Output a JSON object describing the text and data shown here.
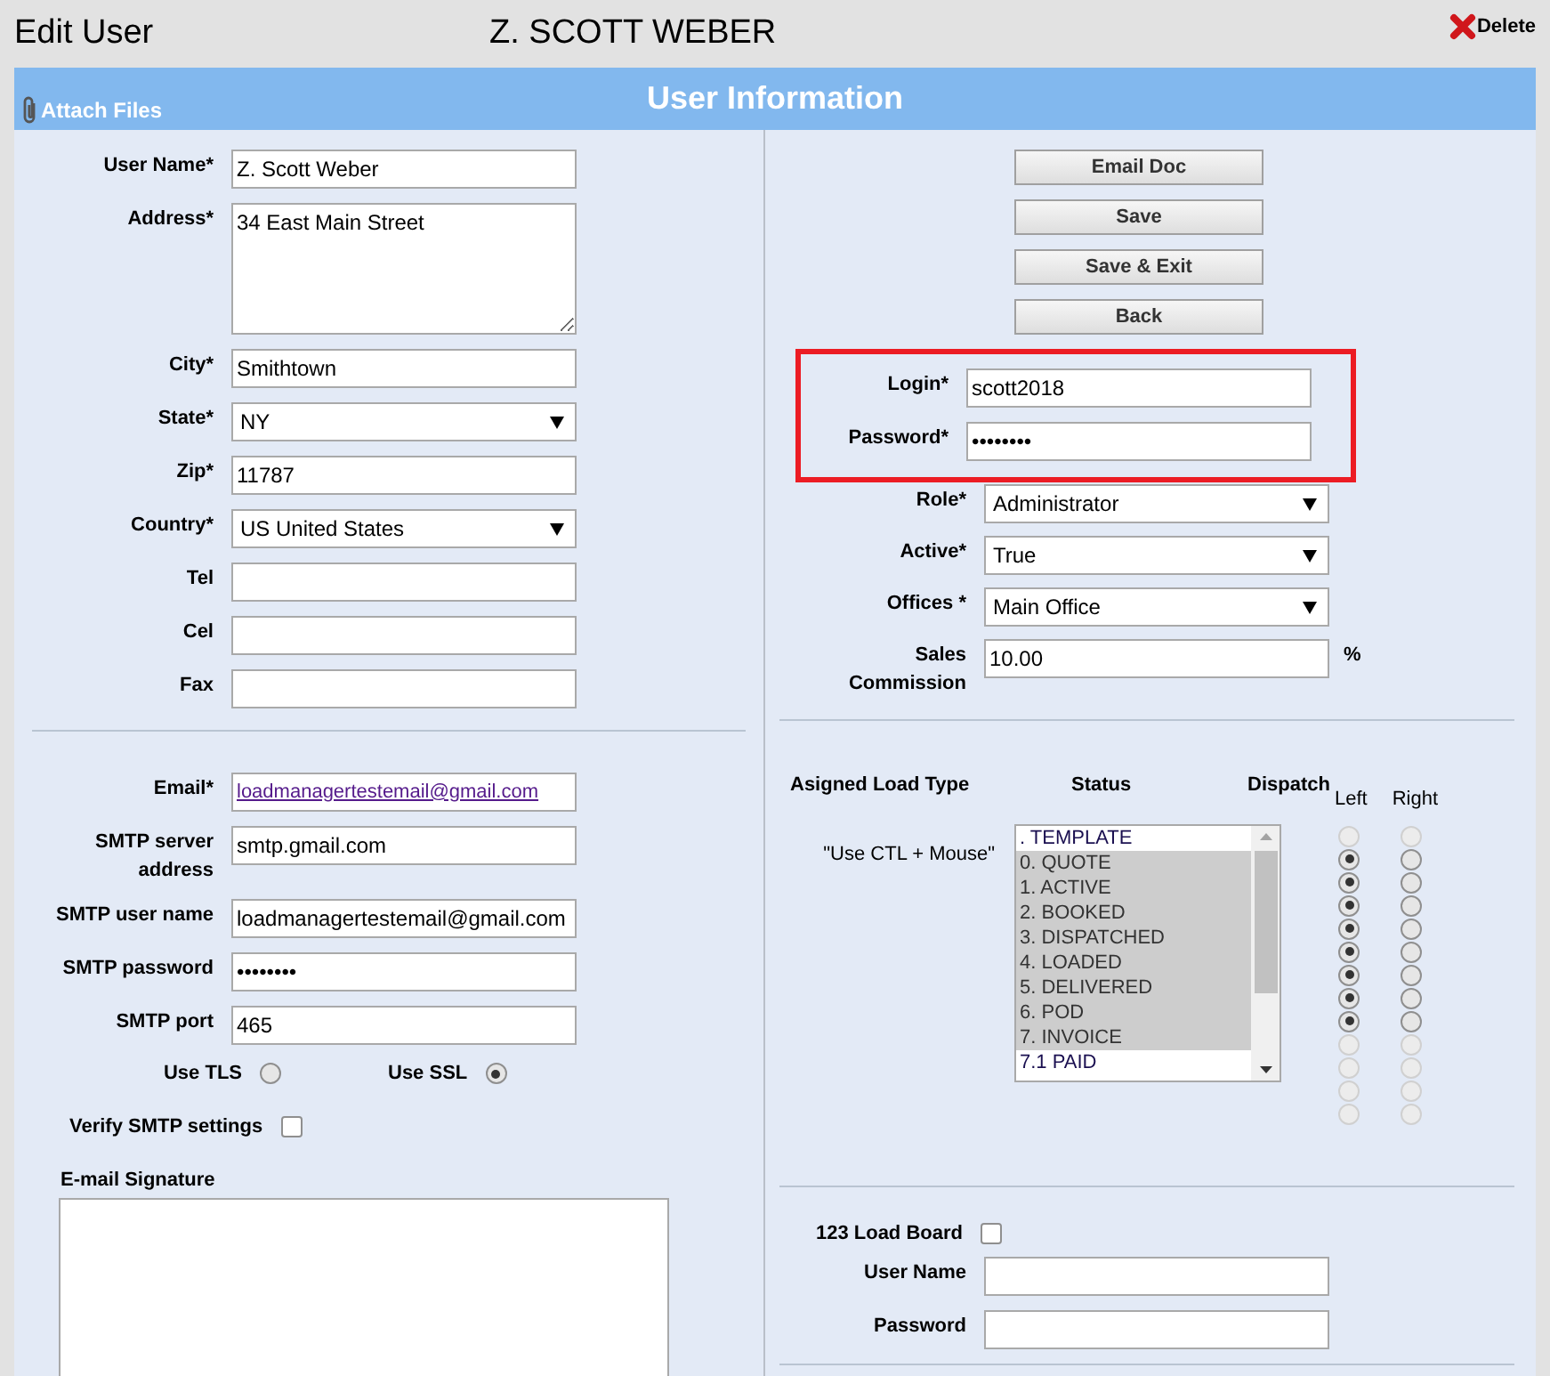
{
  "header": {
    "title": "Edit User",
    "name": "Z. SCOTT WEBER",
    "delete": "Delete"
  },
  "banner": {
    "attach": "Attach Files",
    "title": "User Information"
  },
  "profile_fields": [
    {
      "kind": "text",
      "label": "User Name*",
      "value": "Z. Scott Weber"
    },
    {
      "kind": "textarea",
      "label": "Address*",
      "value": "34 East Main Street"
    },
    {
      "kind": "text",
      "label": "City*",
      "value": "Smithtown"
    },
    {
      "kind": "select",
      "label": "State*",
      "value": "NY"
    },
    {
      "kind": "text",
      "label": "Zip*",
      "value": "11787"
    },
    {
      "kind": "select",
      "label": "Country*",
      "value": "US United States"
    },
    {
      "kind": "text",
      "label": "Tel"
    },
    {
      "kind": "text",
      "label": "Cel"
    },
    {
      "kind": "text",
      "label": "Fax"
    }
  ],
  "email_fields": [
    {
      "kind": "link",
      "label": "Email*",
      "value": "loadmanagertestemail@gmail.com"
    },
    {
      "kind": "text",
      "label": "SMTP server address",
      "value": "smtp.gmail.com"
    },
    {
      "kind": "text",
      "label": "SMTP user name",
      "value": "loadmanagertestemail@gmail.com"
    },
    {
      "kind": "text",
      "label": "SMTP password",
      "value": "••••••••"
    },
    {
      "kind": "text",
      "label": "SMTP port",
      "value": "465"
    }
  ],
  "security": [
    {
      "label": "Use TLS",
      "selected": false
    },
    {
      "label": "Use SSL",
      "selected": true
    }
  ],
  "verify": {
    "label": "Verify SMTP settings",
    "checked": false
  },
  "signature": {
    "label": "E-mail Signature"
  },
  "buttons": [
    "Email Doc",
    "Save",
    "Save & Exit",
    "Back"
  ],
  "credentials": {
    "highlighted": true,
    "fields": [
      {
        "kind": "text",
        "label": "Login*",
        "value": "scott2018"
      },
      {
        "kind": "text",
        "label": "Password*",
        "value": "••••••••"
      }
    ]
  },
  "account_fields": [
    {
      "kind": "select",
      "label": "Role*",
      "value": "Administrator"
    },
    {
      "kind": "select",
      "label": "Active*",
      "value": "True"
    },
    {
      "kind": "select",
      "label": "Offices *",
      "value": "Main Office"
    },
    {
      "kind": "text",
      "label": "Sales Commission",
      "value": "10.00",
      "suffix": "%"
    }
  ],
  "load_types": {
    "headings": [
      "Asigned Load Type",
      "Status",
      "Dispatch"
    ],
    "columns": [
      "Left",
      "Right"
    ],
    "hint": "\"Use CTL + Mouse\"",
    "statuses": [
      {
        "label": ". TEMPLATE",
        "selected": false
      },
      {
        "label": "0. QUOTE",
        "selected": true
      },
      {
        "label": "1. ACTIVE",
        "selected": true
      },
      {
        "label": "2. BOOKED",
        "selected": true
      },
      {
        "label": "3. DISPATCHED",
        "selected": true
      },
      {
        "label": "4. LOADED",
        "selected": true
      },
      {
        "label": "5. DELIVERED",
        "selected": true
      },
      {
        "label": "6. POD",
        "selected": true
      },
      {
        "label": "7. INVOICE",
        "selected": true
      },
      {
        "label": "7.1 PAID",
        "selected": false
      }
    ],
    "dispatch": [
      {
        "disabled": true,
        "left": false,
        "right": false
      },
      {
        "disabled": false,
        "left": true,
        "right": false
      },
      {
        "disabled": false,
        "left": true,
        "right": false
      },
      {
        "disabled": false,
        "left": true,
        "right": false
      },
      {
        "disabled": false,
        "left": true,
        "right": false
      },
      {
        "disabled": false,
        "left": true,
        "right": false
      },
      {
        "disabled": false,
        "left": true,
        "right": false
      },
      {
        "disabled": false,
        "left": true,
        "right": false
      },
      {
        "disabled": false,
        "left": true,
        "right": false
      },
      {
        "disabled": true,
        "left": false,
        "right": false
      },
      {
        "disabled": true,
        "left": false,
        "right": false
      },
      {
        "disabled": true,
        "left": false,
        "right": false
      },
      {
        "disabled": true,
        "left": false,
        "right": false
      }
    ]
  },
  "load_board": {
    "label": "123 Load Board",
    "checked": false,
    "fields": [
      {
        "kind": "text",
        "label": "User Name"
      },
      {
        "kind": "text",
        "label": "Password"
      }
    ]
  }
}
